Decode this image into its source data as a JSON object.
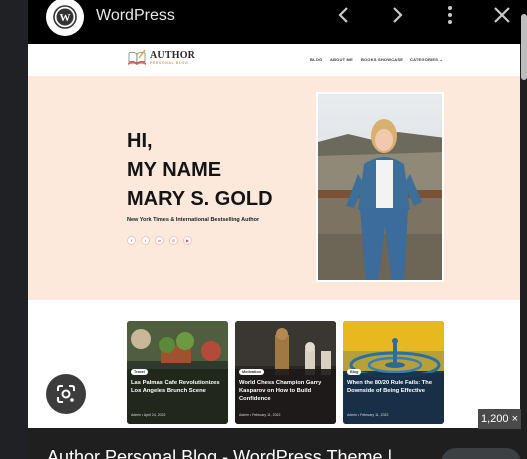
{
  "viewer": {
    "app_title": "WordPress",
    "size_badge": "1,200 ×",
    "bottom_title": "Author Personal Blog - WordPress Theme |"
  },
  "icons": {
    "back": "chevron-left-icon",
    "forward": "chevron-right-icon",
    "more": "more-vert-icon",
    "close": "close-icon",
    "lens": "google-lens-icon"
  },
  "site": {
    "logo_name": "AUTHOR",
    "logo_sub": "PERSONAL BLOG",
    "menu": [
      "BLOG",
      "ABOUT ME",
      "BOOKS SHOWCASE",
      "CATEGORIES ⌄"
    ],
    "hero_lines": [
      "HI,",
      "MY NAME",
      "MARY S. GOLD"
    ],
    "hero_sub": "New York Times & International Bestselling Author",
    "socials": [
      "f",
      "t",
      "in",
      "◎",
      "▶"
    ],
    "accent": "#fde8dc",
    "cards": [
      {
        "tag": "Travel",
        "title": "Las Palmas Cafe Revolutionizes Los Angeles Brunch Scene",
        "meta": "Admin  •  April 24, 2022"
      },
      {
        "tag": "Motivation",
        "title": "World Chess Champion Garry Kasparov on How to Build Confidence",
        "meta": "Admin  •  February 11, 2022"
      },
      {
        "tag": "Blog",
        "title": "When the 80/20 Rule Fails: The Downside of Being Effective",
        "meta": "Admin  •  February 11, 2022"
      }
    ]
  }
}
